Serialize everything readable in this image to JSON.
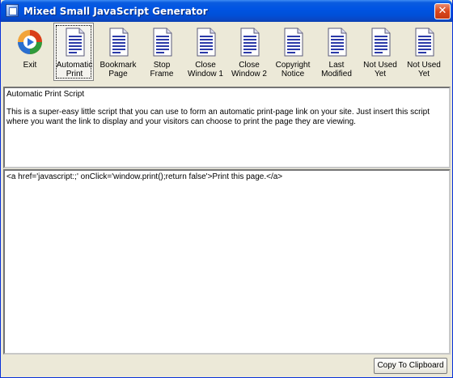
{
  "window": {
    "title": "Mixed Small JavaScript Generator"
  },
  "toolbar": {
    "buttons": [
      {
        "label": "Exit",
        "icon": "exit-icon",
        "active": false
      },
      {
        "label": "Automatic Print",
        "icon": "document-icon",
        "active": true
      },
      {
        "label": "Bookmark Page",
        "icon": "document-icon",
        "active": false
      },
      {
        "label": "Stop Frame",
        "icon": "document-icon",
        "active": false
      },
      {
        "label": "Close Window 1",
        "icon": "document-icon",
        "active": false
      },
      {
        "label": "Close Window 2",
        "icon": "document-icon",
        "active": false
      },
      {
        "label": "Copyright Notice",
        "icon": "document-icon",
        "active": false
      },
      {
        "label": "Last Modified",
        "icon": "document-icon",
        "active": false
      },
      {
        "label": "Not Used Yet",
        "icon": "document-icon",
        "active": false
      },
      {
        "label": "Not Used Yet",
        "icon": "document-icon",
        "active": false
      }
    ]
  },
  "description": {
    "title": "Automatic Print Script",
    "body": "This is a super-easy little script that you can use to form an automatic print-page link on your site. Just insert this script where you want the link to display and your visitors can choose to print the page they are viewing."
  },
  "code": {
    "text": "<a href='javascript:;' onClick='window.print();return false'>Print this page.</a>"
  },
  "actions": {
    "copy_label": "Copy To Clipboard"
  },
  "colors": {
    "titlebar": "#0054e3",
    "window_bg": "#ece9d8",
    "doc_icon_stripes": "#2b3aa8",
    "exit_icon_ring": "#e87a1e"
  }
}
